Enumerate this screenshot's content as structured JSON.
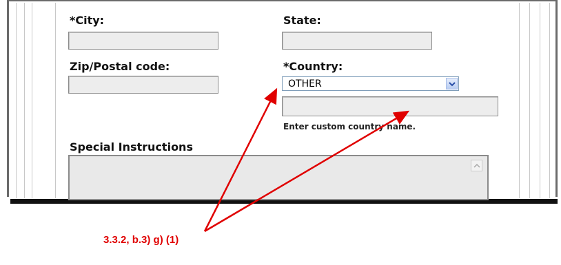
{
  "form": {
    "city_label": "*City:",
    "state_label": "State:",
    "zip_label": "Zip/Postal code:",
    "country_label": "*Country:",
    "city_value": "",
    "state_value": "",
    "zip_value": "",
    "country_selected": "OTHER",
    "custom_country_value": "",
    "custom_country_hint": "Enter custom country name.",
    "special_instructions_label": "Special Instructions",
    "special_instructions_value": ""
  },
  "annotation": {
    "callout_text": "3.3.2, b.3) g) (1)",
    "color": "#e00000"
  },
  "colors": {
    "field_bg": "#ededed",
    "frame_border": "#6b6b6b",
    "select_arrow": "#2a4fa8"
  },
  "icons": {
    "dropdown": "chevron-down-icon",
    "scroll_up": "scroll-up-arrow-icon"
  }
}
